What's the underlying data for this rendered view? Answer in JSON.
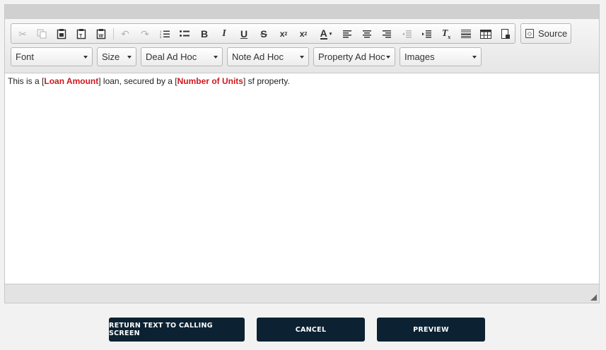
{
  "toolbar": {
    "source_label": "Source",
    "icons": [
      "cut-icon",
      "copy-icon",
      "paste-icon",
      "paste-text-icon",
      "paste-word-icon",
      "undo-icon",
      "redo-icon",
      "numbered-list-icon",
      "bulleted-list-icon",
      "bold-icon",
      "italic-icon",
      "underline-icon",
      "strikethrough-icon",
      "superscript-icon",
      "subscript-icon",
      "text-color-icon",
      "align-left-icon",
      "align-center-icon",
      "align-right-icon",
      "outdent-icon",
      "indent-icon",
      "remove-format-icon",
      "horizontal-line-icon",
      "table-icon",
      "page-break-icon",
      "source-icon"
    ]
  },
  "combos": {
    "font": "Font",
    "size": "Size",
    "deal_ad_hoc": "Deal Ad Hoc",
    "note_ad_hoc": "Note Ad Hoc",
    "property_ad_hoc": "Property Ad Hoc",
    "images": "Images"
  },
  "content": {
    "text_1": "This is a [",
    "field_1": "Loan Amount",
    "text_2": "] loan, secured by a [",
    "field_2": "Number of Units",
    "text_3": "] sf property."
  },
  "colors": {
    "field_highlight": "#d0181c",
    "button_bg": "#0c2233"
  },
  "actions": {
    "return_label": "RETURN TEXT TO CALLING SCREEN",
    "cancel_label": "CANCEL",
    "preview_label": "PREVIEW"
  }
}
